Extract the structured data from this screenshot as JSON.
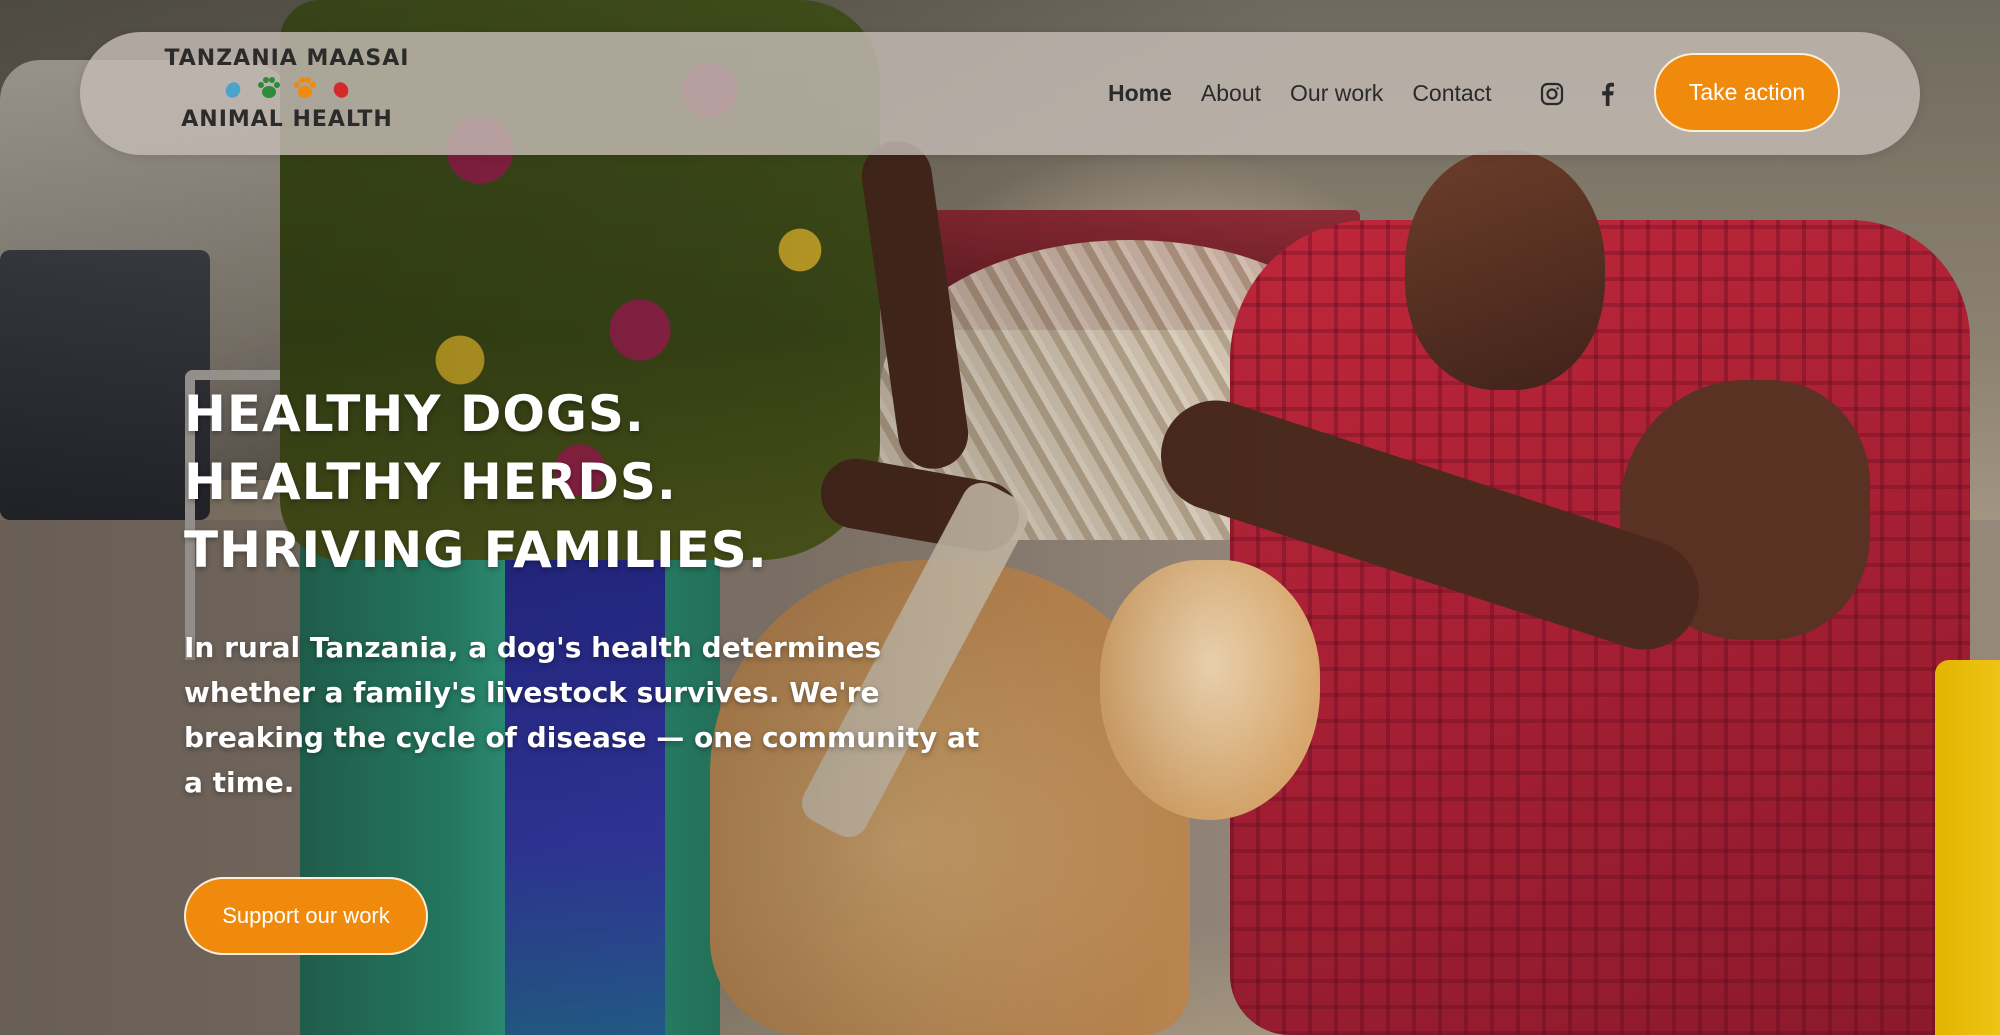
{
  "brand": {
    "line1": "TANZANIA MAASAI",
    "line2": "ANIMAL HEALTH",
    "paw_colors": [
      "#4aa3c8",
      "#2e8b3c",
      "#ef8a0c",
      "#d42a2a"
    ]
  },
  "nav": {
    "links": [
      {
        "label": "Home",
        "active": true
      },
      {
        "label": "About"
      },
      {
        "label": "Our work"
      },
      {
        "label": "Contact"
      }
    ],
    "social": [
      "instagram-icon",
      "facebook-icon"
    ],
    "cta_label": "Take action"
  },
  "hero": {
    "headline": [
      "HEALTHY DOGS.",
      "HEALTHY HERDS.",
      "THRIVING FAMILIES."
    ],
    "body": "In rural Tanzania, a dog's health determines whether a family's livestock survives. We're breaking the cycle of disease — one community at a time.",
    "cta_label": "Support our work"
  },
  "colors": {
    "accent": "#ef8a0c",
    "nav_bg": "#c4bcb4",
    "text_dark": "#2a2a2a",
    "text_light": "#ffffff"
  }
}
